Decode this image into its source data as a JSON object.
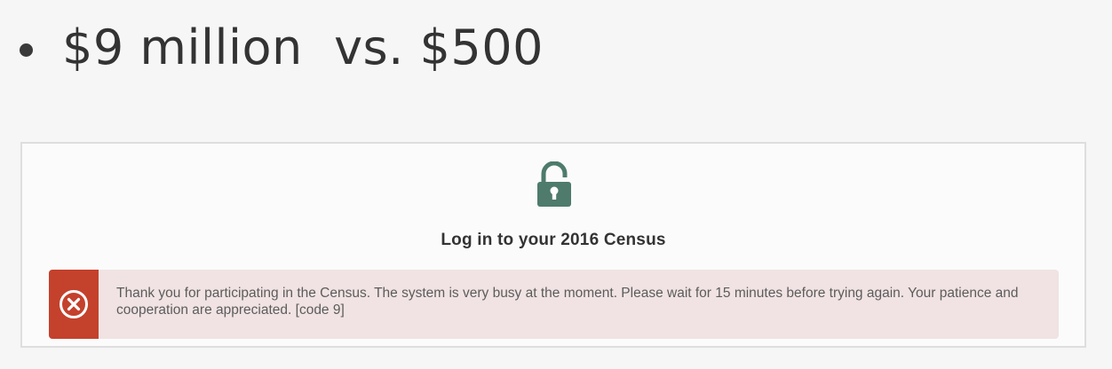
{
  "slide": {
    "bullet_text": "$9 million  vs. $500"
  },
  "login": {
    "lock_icon": "lock-icon",
    "title": "Log in to your 2016 Census",
    "error": {
      "icon": "close-circle-icon",
      "message": "Thank you for participating in the Census. The system is very busy at the moment. Please wait for 15 minutes before trying again. Your patience and cooperation are appreciated. [code 9]"
    }
  },
  "colors": {
    "lock": "#4e7b6b",
    "error_accent": "#c4412c",
    "error_background": "#f1e3e3",
    "background": "#f6f6f6"
  }
}
